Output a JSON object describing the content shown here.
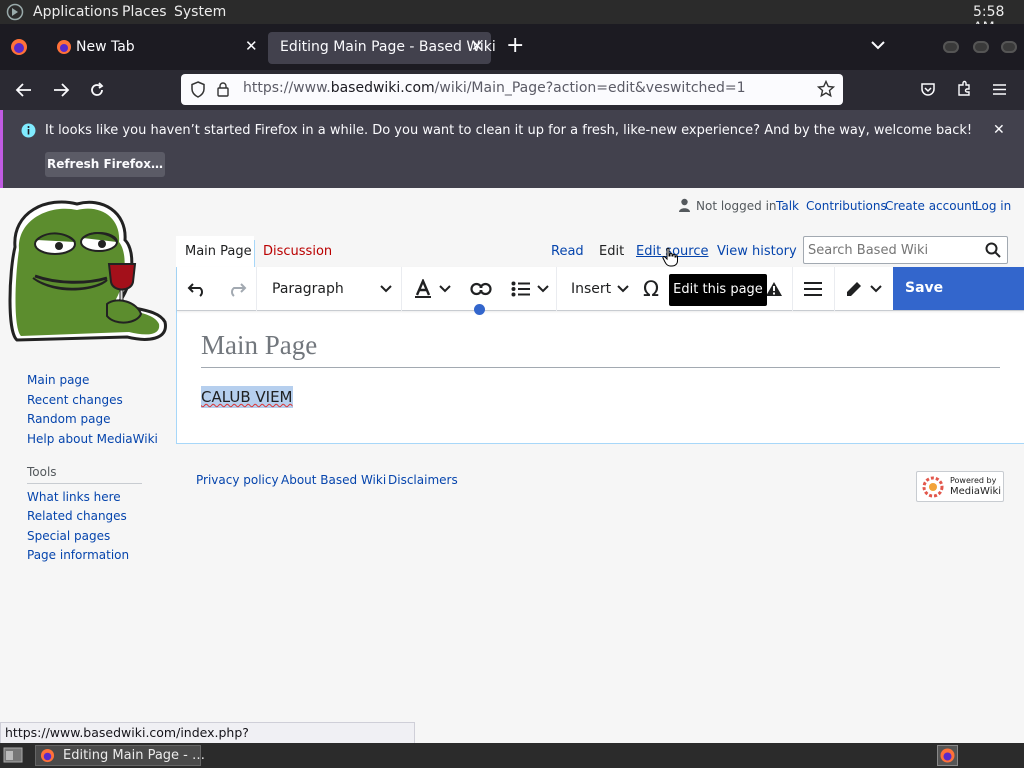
{
  "panel": {
    "applications": "Applications",
    "places": "Places",
    "system": "System",
    "clock": "5:58 AM"
  },
  "tabs": [
    {
      "label": "New Tab"
    },
    {
      "label": "Editing Main Page - Based Wiki"
    }
  ],
  "urlbar": {
    "prefix": "https://www.",
    "domain": "basedwiki.com",
    "path": "/wiki/Main_Page?action=edit&veswitched=1"
  },
  "notification": {
    "message": "It looks like you haven’t started Firefox in a while. Do you want to clean it up for a fresh, like-new experience? And by the way, welcome back!",
    "button": "Refresh Firefox…"
  },
  "personal": {
    "not_logged_in": "Not logged in",
    "talk": "Talk",
    "contributions": "Contributions",
    "create_account": "Create account",
    "log_in": "Log in"
  },
  "ns_tabs": {
    "main_page": "Main Page",
    "discussion": "Discussion"
  },
  "view_tabs": {
    "read": "Read",
    "edit": "Edit",
    "edit_source": "Edit source",
    "view_history": "View history"
  },
  "search": {
    "placeholder": "Search Based Wiki"
  },
  "toolbar": {
    "paragraph": "Paragraph",
    "insert": "Insert",
    "save": "Save changes…",
    "tooltip": "Edit this page",
    "special_char": "Ω"
  },
  "article": {
    "title": "Main Page",
    "body": "CALUB VIEM"
  },
  "sidebar": {
    "nav": [
      "Main page",
      "Recent changes",
      "Random page",
      "Help about MediaWiki"
    ],
    "tools_heading": "Tools",
    "tools": [
      "What links here",
      "Related changes",
      "Special pages",
      "Page information"
    ]
  },
  "footer": {
    "privacy": "Privacy policy",
    "about": "About Based Wiki",
    "disclaimers": "Disclaimers",
    "powered_line1": "Powered by",
    "powered_line2": "MediaWiki"
  },
  "status_url": "https://www.basedwiki.com/index.php?title=Main_Page&action=edit",
  "taskbar": {
    "window": "Editing Main Page - …"
  },
  "colors": {
    "link": "#0645ad",
    "accent": "#3366cc",
    "red_link": "#ba0000"
  }
}
